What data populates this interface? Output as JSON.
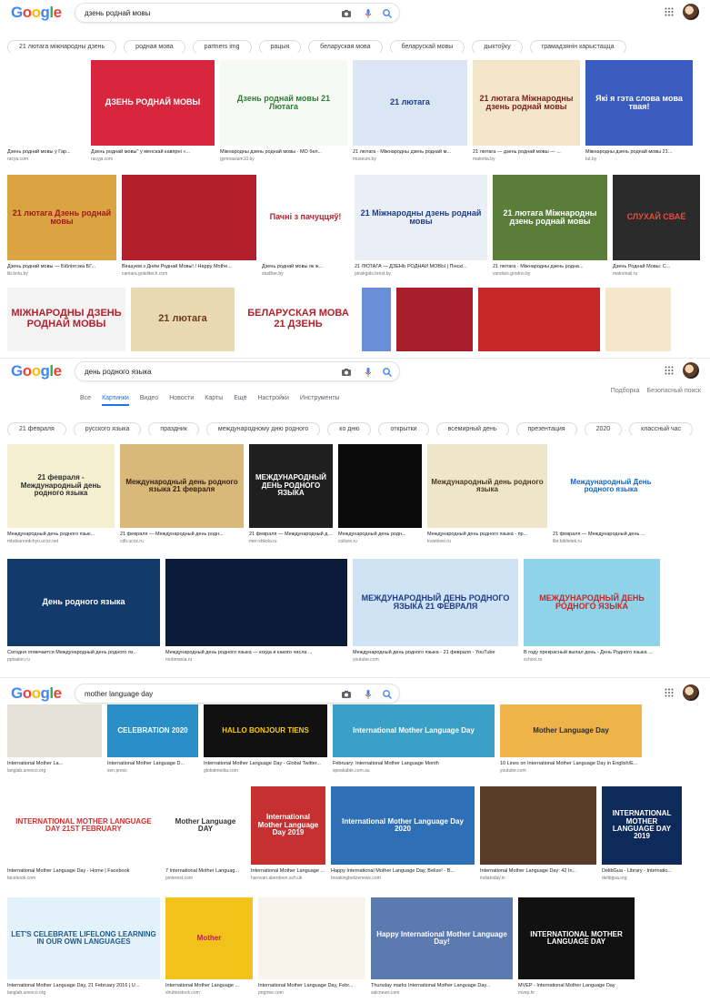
{
  "logo_text": "Google",
  "icons": {
    "camera": "camera-icon",
    "mic": "microphone-icon",
    "search": "search-icon",
    "apps": "apps-grid-icon"
  },
  "colors": {
    "blue": "#4285F4",
    "red": "#EA4335",
    "yellow": "#FBBC05",
    "green": "#34A853",
    "accent": "#1a73e8"
  },
  "panel1": {
    "query": "дзень роднай мовы",
    "chips": [
      "21 лютага міжнародны дзень",
      "родная мова",
      "partners img",
      "рацыя",
      "беларуская мова",
      "беларускай мовы",
      "дыктоўку",
      "грамадзянін карыстацца"
    ],
    "row1": [
      {
        "caption": "Дзень роднай мовы ў Гар...",
        "source": "racya.com",
        "text": "",
        "bg": "#ffffff",
        "fg": "#c0392b"
      },
      {
        "caption": "Дзень роднай мовы\" у менскай кавярні «...",
        "source": "racyja.com",
        "text": "ДЗЕНЬ РОДНАЙ МОВЫ",
        "bg": "#d7263d",
        "fg": "#ffffff"
      },
      {
        "caption": "Міжнародны дзень роднай мовы - МО бел...",
        "source": "gymnasium10.by",
        "text": "Дзень роднай мовы 21 Лютага",
        "bg": "#f7f9f4",
        "fg": "#2e7d32"
      },
      {
        "caption": "21 лютага - Міжнародны дзень роднай м...",
        "source": "museum.by",
        "text": "21 лютага",
        "bg": "#dbe6f5",
        "fg": "#1f3c88"
      },
      {
        "caption": "21 лютага — дзень роднай мовы — ...",
        "source": "malorita.by",
        "text": "21 лютага Міжнародны дзень роднай мовы",
        "bg": "#f3e6c8",
        "fg": "#7a1f1f"
      },
      {
        "caption": "Міжнародны дзень роднай мовы 21...",
        "source": "tut.by",
        "text": "Які я гэта слова мова твая!",
        "bg": "#3a5bbf",
        "fg": "#ffffff"
      }
    ],
    "row2": [
      {
        "caption": "Дзень роднай мовы — Бібліятэка БГ...",
        "source": "lib.bntu.by",
        "text": "21 лютага Дзень роднай мовы",
        "bg": "#d9a441",
        "fg": "#a3181c"
      },
      {
        "caption": "Віншуем з Днём Роднай Мовы! / Happy Mothe...",
        "source": "camara.gotelitech.com",
        "text": "",
        "bg": "#b3202c",
        "fg": "#ffffff"
      },
      {
        "caption": "Дзень роднай мовы як ж...",
        "source": "studlive.by",
        "text": "Пачні з пачуццяў!",
        "bg": "#ffffff",
        "fg": "#b3202c"
      },
      {
        "caption": "21 ЛЮТАГА — ДЗЕНЬ РОДНАЙ МОВЫ | Пінскі...",
        "source": "pinskgids.brest.by",
        "text": "21 Міжнародны дзень роднай мовы",
        "bg": "#e9eef7",
        "fg": "#1f3c88"
      },
      {
        "caption": "21 лютага - Міжнародны дзень родна...",
        "source": "vandars.grodno.by",
        "text": "21 лютага Міжнародны дзень роднай мовы",
        "bg": "#5b7d3a",
        "fg": "#ffffff"
      },
      {
        "caption": "Дзень Роднай Мовы: С...",
        "source": "malorinail.ru",
        "text": "СЛУХАЙ СВАЁ",
        "bg": "#2b2b2b",
        "fg": "#e74c3c"
      }
    ],
    "row3": [
      {
        "text": "МІЖНАРОДНЫ ДЗЕНЬ РОДНАЙ МОВЫ",
        "bg": "#f3f3f3",
        "fg": "#b3202c"
      },
      {
        "text": "21 лютага",
        "bg": "#e8d9b0",
        "fg": "#6b3b1a"
      },
      {
        "text": "БЕЛАРУСКАЯ МОВА 21 ДЗЕНЬ",
        "bg": "#ffffff",
        "fg": "#b3202c"
      },
      {
        "text": "",
        "bg": "#6a8ed8",
        "fg": "#ffffff"
      },
      {
        "text": "",
        "bg": "#a81e2b",
        "fg": "#ffffff"
      },
      {
        "text": "",
        "bg": "#c62828",
        "fg": "#ffffff"
      },
      {
        "text": "",
        "bg": "#f5e7c9",
        "fg": "#7a1f1f"
      }
    ]
  },
  "panel2": {
    "query": "день родного языка",
    "tabs": [
      "Все",
      "Картинки",
      "Видео",
      "Новости",
      "Карты",
      "Ещё",
      "Настройки",
      "Инструменты"
    ],
    "tools_right": [
      "Подборка",
      "Безопасный поиск"
    ],
    "chips": [
      "21 февраля",
      "русского языка",
      "праздник",
      "международному дню родного",
      "ко дню",
      "открытки",
      "всемирный день",
      "презентация",
      "2020",
      "классный час"
    ],
    "row1": [
      {
        "caption": "Международный день родного язык...",
        "source": "mbdounordchyo.ucoz.net",
        "text": "21 февраля - Международный день родного языка",
        "bg": "#f4efd0",
        "fg": "#2d2d2d"
      },
      {
        "caption": "21 февраля — Международный день родн...",
        "source": "cdb.ucoz.ru",
        "text": "Международный день родного языка 21 февраля",
        "bg": "#d8b97a",
        "fg": "#3a2410"
      },
      {
        "caption": "21 февраля — Международный день...",
        "source": "mer-shkola.ru",
        "text": "МЕЖДУНАРОДНЫЙ ДЕНЬ РОДНОГО ЯЗЫКА",
        "bg": "#1f1f1f",
        "fg": "#ffffff"
      },
      {
        "caption": "Международный день родн...",
        "source": "culture.ru",
        "text": "",
        "bg": "#0b0b0b",
        "fg": "#ffffff"
      },
      {
        "caption": "Международный день родного языка - пр...",
        "source": "kvantovo.ru",
        "text": "Международный день родного языка",
        "bg": "#eee6c9",
        "fg": "#4a3a1a"
      },
      {
        "caption": "21 февраля — Международный день ...",
        "source": "libr.bibliotek.ru",
        "text": "Международный День родного языка",
        "bg": "#ffffff",
        "fg": "#1565c0"
      }
    ],
    "row2": [
      {
        "caption": "Сегодня отмечается Международный день родного яз...",
        "source": "pptsalon.ru",
        "text": "День родного языка",
        "bg": "#123a6b",
        "fg": "#ffffff"
      },
      {
        "caption": "Международный день родного языка — когда и какого числа ...",
        "source": "mobmania.ru",
        "text": "",
        "bg": "#0d1b3a",
        "fg": "#9ec5ff"
      },
      {
        "caption": "Международный день родного языка - 21 февраля - YouTube",
        "source": "youtube.com",
        "text": "МЕЖДУНАРОДНЫЙ ДЕНЬ РОДНОГО ЯЗЫКА 21 ФЕВРАЛЯ",
        "bg": "#cfe3f5",
        "fg": "#1f3c88"
      },
      {
        "caption": "В году прекрасный выпал день - День Родного языка ...",
        "source": "school.ru",
        "text": "МЕЖДУНАРОДНЫЙ ДЕНЬ РОДНОГО ЯЗЫКА",
        "bg": "#8fd3e8",
        "fg": "#c62828"
      }
    ]
  },
  "panel3": {
    "query": "mother language day",
    "row0": [
      {
        "caption": "International Mother La...",
        "source": "langlab.unesco.org",
        "text": "",
        "bg": "#e6e1d8",
        "fg": "#333"
      },
      {
        "caption": "International Mother Language D...",
        "source": "sen.press",
        "text": "CELEBRATION 2020",
        "bg": "#2a8fc7",
        "fg": "#ffffff"
      },
      {
        "caption": "International Mother Language Day - Global Twitter...",
        "source": "globalmedia.com",
        "text": "HALLO BONJOUR TIENS",
        "bg": "#111111",
        "fg": "#ffcc00"
      },
      {
        "caption": "February: International Mother Language Month",
        "source": "speakable.com.au",
        "text": "International Mother Language Day",
        "bg": "#3aa0c8",
        "fg": "#ffffff"
      },
      {
        "caption": "10 Lines on International Mother Language Day in English/E...",
        "source": "youtube.com",
        "text": "Mother Language Day",
        "bg": "#eeb44a",
        "fg": "#2a2a2a"
      }
    ],
    "row1": [
      {
        "caption": "International Mother Language Day - Home | Facebook",
        "source": "facebook.com",
        "text": "INTERNATIONAL MOTHER LANGUAGE DAY 21ST FEBRUARY",
        "bg": "#ffffff",
        "fg": "#d32f2f"
      },
      {
        "caption": "7 International Mother Languag...",
        "source": "pinterest.com",
        "text": "Mother Language DAY",
        "bg": "#ffffff",
        "fg": "#333333"
      },
      {
        "caption": "International Mother Language ...",
        "source": "harovan.aberdeen.sch.uk",
        "text": "International Mother Language Day 2019",
        "bg": "#c53030",
        "fg": "#ffffff"
      },
      {
        "caption": "Happy International Mother Language Day, Belize! - B...",
        "source": "breakingbelizenews.com",
        "text": "International Mother Language Day 2020",
        "bg": "#2f6fb5",
        "fg": "#ffffff"
      },
      {
        "caption": "International Mother Language Day: 42 In...",
        "source": "indiatoday.in",
        "text": "",
        "bg": "#5a3b2a",
        "fg": "#ffffff"
      },
      {
        "caption": "DelibGua - Library - Internatio...",
        "source": "delibgua.org",
        "text": "INTERNATIONAL MOTHER LANGUAGE DAY 2019",
        "bg": "#0e2a5a",
        "fg": "#ffffff"
      }
    ],
    "row2": [
      {
        "caption": "International Mother Language Day, 21 February 2016 | U...",
        "source": "langlab.unesco.org",
        "text": "LET'S CELEBRATE LIFELONG LEARNING IN OUR OWN LANGUAGES",
        "bg": "#e3f1fb",
        "fg": "#1f5a8a"
      },
      {
        "caption": "International Mother Language ...",
        "source": "shutterstock.com",
        "text": "Mother",
        "bg": "#f2c21b",
        "fg": "#c2185b"
      },
      {
        "caption": "International Mother Language Day, Febr...",
        "source": "pngtree.com",
        "text": "",
        "bg": "#f7f4ec",
        "fg": "#333"
      },
      {
        "caption": "Thursday marks International Mother Language Day...",
        "source": "salcnews.com",
        "text": "Happy International Mother Language Day!",
        "bg": "#5a7ab0",
        "fg": "#ffffff"
      },
      {
        "caption": "MVEP - International Mother Language Day",
        "source": "mvep.hr",
        "text": "INTERNATIONAL MOTHER LANGUAGE DAY",
        "bg": "#111111",
        "fg": "#ffffff"
      }
    ]
  }
}
